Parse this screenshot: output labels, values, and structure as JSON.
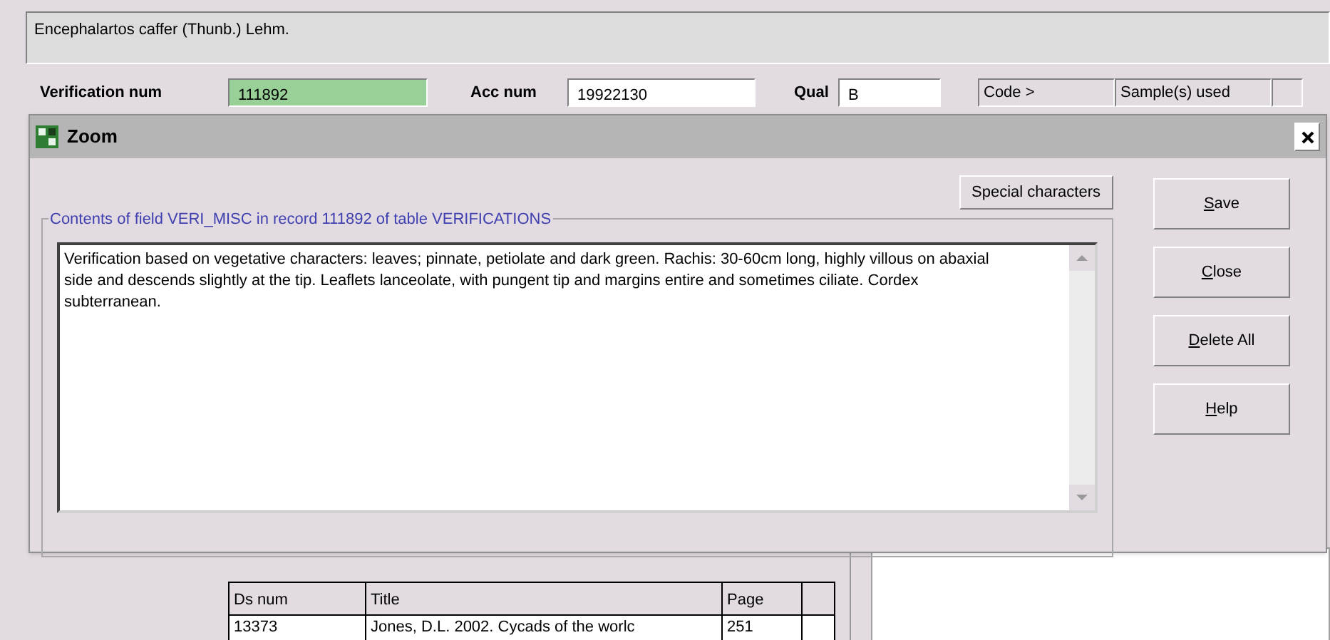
{
  "record_title": "Encephalartos caffer (Thunb.) Lehm.",
  "fields": [
    {
      "label": "Verification num",
      "value": "111892",
      "highlighted": true
    },
    {
      "label": "Acc num",
      "value": "19922130",
      "highlighted": false
    },
    {
      "label": "Qual",
      "value": "B",
      "highlighted": false
    }
  ],
  "header_buttons": [
    "Code >",
    "Sample(s) used"
  ],
  "dialog": {
    "title": "Zoom",
    "special_button": "Special characters",
    "group_label": "Contents of field VERI_MISC in record 111892 of table VERIFICATIONS",
    "text": "Verification based on vegetative characters: leaves; pinnate, petiolate and dark green.  Rachis: 30-60cm long, highly villous on abaxial side and descends slightly at the tip. Leaflets lanceolate, with pungent tip and margins entire and sometimes ciliate. Cordex subterranean.",
    "buttons": [
      {
        "label": "Save",
        "mnemonic": true
      },
      {
        "label": "Close",
        "mnemonic": true
      },
      {
        "label": "Delete All",
        "mnemonic": true
      },
      {
        "label": "Help",
        "mnemonic": true
      }
    ]
  },
  "table": {
    "columns": [
      "Ds num",
      "Title",
      "Page"
    ],
    "rows": [
      [
        "13373",
        "Jones, D.L. 2002. Cycads of the worlc",
        "251"
      ]
    ]
  }
}
